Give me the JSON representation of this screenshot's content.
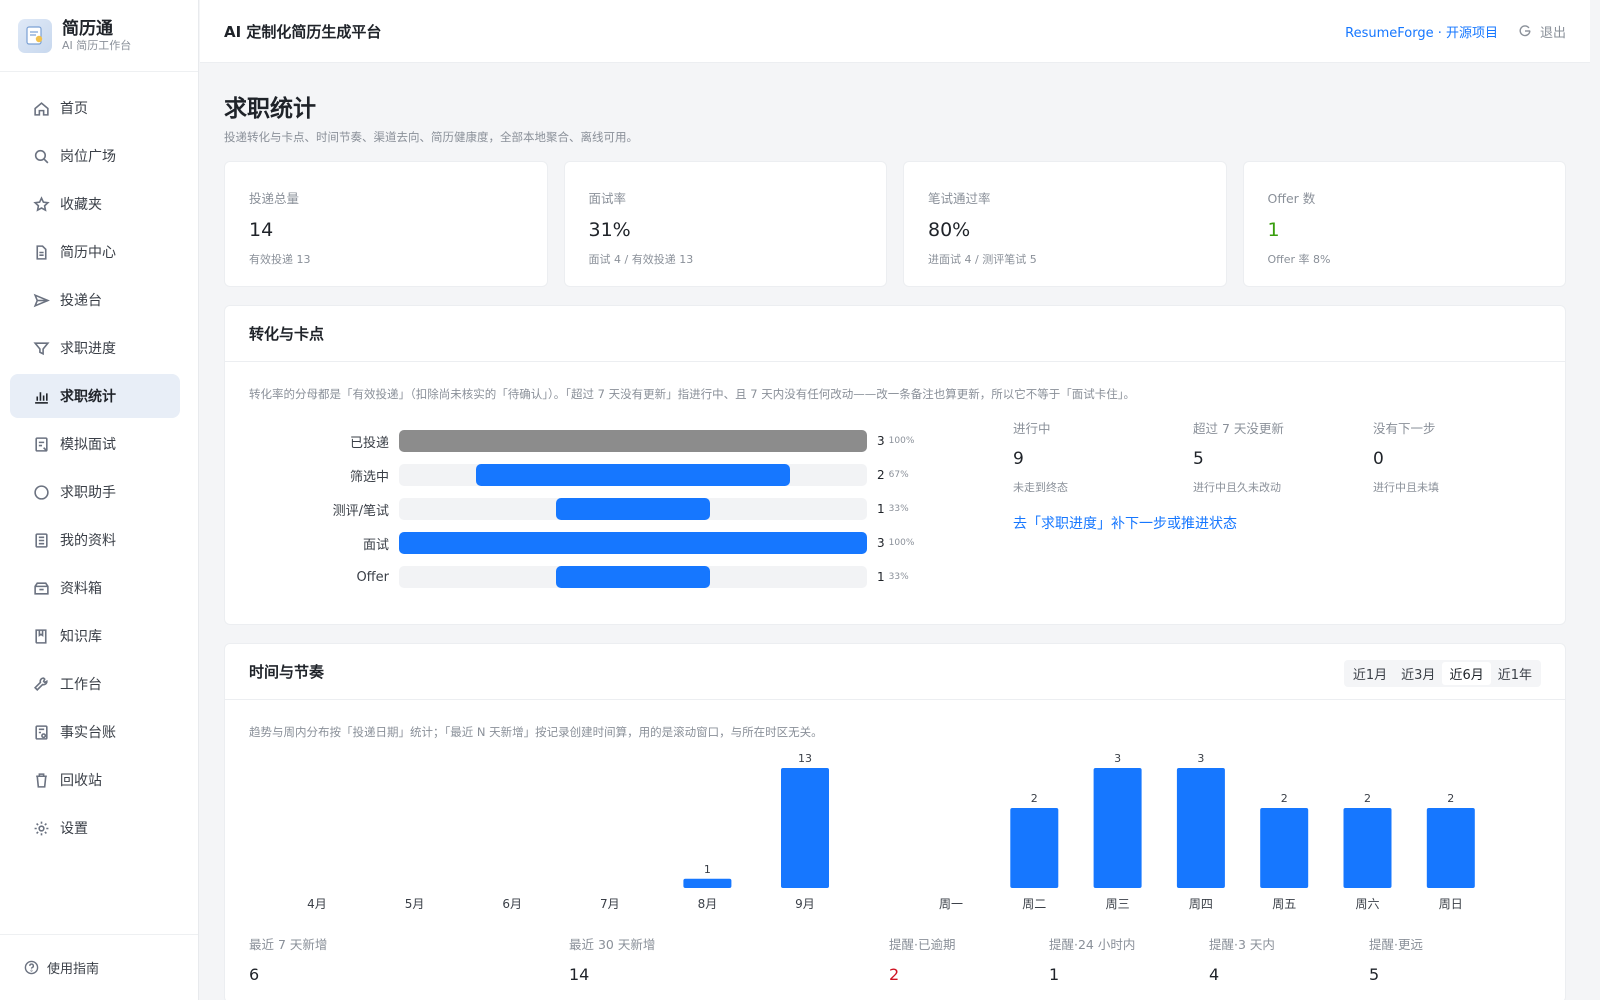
{
  "brand": {
    "name": "简历通",
    "subtitle": "AI 简历工作台"
  },
  "topbar": {
    "title": "AI 定制化简历生成平台",
    "link": "ResumeForge · 开源项目",
    "logout": "退出"
  },
  "sidebar": {
    "items": [
      {
        "label": "首页",
        "icon": "home-icon"
      },
      {
        "label": "岗位广场",
        "icon": "search-icon"
      },
      {
        "label": "收藏夹",
        "icon": "star-icon"
      },
      {
        "label": "简历中心",
        "icon": "document-icon"
      },
      {
        "label": "投递台",
        "icon": "send-icon"
      },
      {
        "label": "求职进度",
        "icon": "filter-icon"
      },
      {
        "label": "求职统计",
        "icon": "bar-chart-icon",
        "active": true
      },
      {
        "label": "模拟面试",
        "icon": "interview-icon"
      },
      {
        "label": "求职助手",
        "icon": "chat-icon"
      },
      {
        "label": "我的资料",
        "icon": "profile-list-icon"
      },
      {
        "label": "资料箱",
        "icon": "box-icon"
      },
      {
        "label": "知识库",
        "icon": "book-icon"
      },
      {
        "label": "工作台",
        "icon": "wrench-icon"
      },
      {
        "label": "事实台账",
        "icon": "ledger-icon"
      },
      {
        "label": "回收站",
        "icon": "trash-icon"
      },
      {
        "label": "设置",
        "icon": "gear-icon"
      }
    ],
    "footer": "使用指南"
  },
  "page": {
    "title": "求职统计",
    "subtitle": "投递转化与卡点、时间节奏、渠道去向、简历健康度，全部本地聚合、离线可用。"
  },
  "stats": [
    {
      "label": "投递总量",
      "value": "14",
      "note": "有效投递 13"
    },
    {
      "label": "面试率",
      "value": "31%",
      "note": "面试 4 / 有效投递 13"
    },
    {
      "label": "笔试通过率",
      "value": "80%",
      "note": "进面试 4 / 测评笔试 5"
    },
    {
      "label": "Offer 数",
      "value": "1",
      "note": "Offer 率 8%",
      "color": "#389e0d"
    }
  ],
  "conversion": {
    "title": "转化与卡点",
    "note": "转化率的分母都是「有效投递」（扣除尚未核实的「待确认」）。「超过 7 天没有更新」指进行中、且 7 天内没有任何改动——改一条备注也算更新，所以它不等于「面试卡住」。",
    "funnel": [
      {
        "label": "已投递",
        "value": "3",
        "pct": "100%",
        "fraction": 1.0,
        "color": "#8c8c8c"
      },
      {
        "label": "筛选中",
        "value": "2",
        "pct": "67%",
        "fraction": 0.67,
        "color": "#1677ff"
      },
      {
        "label": "测评/笔试",
        "value": "1",
        "pct": "33%",
        "fraction": 0.33,
        "color": "#1677ff"
      },
      {
        "label": "面试",
        "value": "3",
        "pct": "100%",
        "fraction": 1.0,
        "color": "#1677ff"
      },
      {
        "label": "Offer",
        "value": "1",
        "pct": "33%",
        "fraction": 0.33,
        "color": "#1677ff"
      }
    ],
    "kpis": [
      {
        "label": "进行中",
        "value": "9",
        "note": "未走到终态"
      },
      {
        "label": "超过 7 天没更新",
        "value": "5",
        "note": "进行中且久未改动"
      },
      {
        "label": "没有下一步",
        "value": "0",
        "note": "进行中且未填"
      }
    ],
    "link": "去「求职进度」补下一步或推进状态"
  },
  "rhythm": {
    "title": "时间与节奏",
    "note": "趋势与周内分布按「投递日期」统计；「最近 N 天新增」按记录创建时间算，用的是滚动窗口，与所在时区无关。",
    "ranges": [
      "近1月",
      "近3月",
      "近6月",
      "近1年"
    ],
    "active_range": "近6月",
    "bottom_stats": [
      {
        "label": "最近 7 天新增",
        "value": "6"
      },
      {
        "label": "最近 30 天新增",
        "value": "14"
      },
      {
        "label": "提醒·已逾期",
        "value": "2",
        "color": "#cf1322"
      },
      {
        "label": "提醒·24 小时内",
        "value": "1"
      },
      {
        "label": "提醒·3 天内",
        "value": "4"
      },
      {
        "label": "提醒·更远",
        "value": "5"
      }
    ]
  },
  "chart_data": [
    {
      "type": "bar",
      "categories": [
        "4月",
        "5月",
        "6月",
        "7月",
        "8月",
        "9月"
      ],
      "values": [
        0,
        0,
        0,
        0,
        1,
        13
      ],
      "ylim": [
        0,
        13
      ],
      "color": "#1677ff"
    },
    {
      "type": "bar",
      "categories": [
        "周一",
        "周二",
        "周三",
        "周四",
        "周五",
        "周六",
        "周日"
      ],
      "values": [
        0,
        2,
        3,
        3,
        2,
        2,
        2
      ],
      "ylim": [
        0,
        3
      ],
      "color": "#1677ff"
    }
  ]
}
